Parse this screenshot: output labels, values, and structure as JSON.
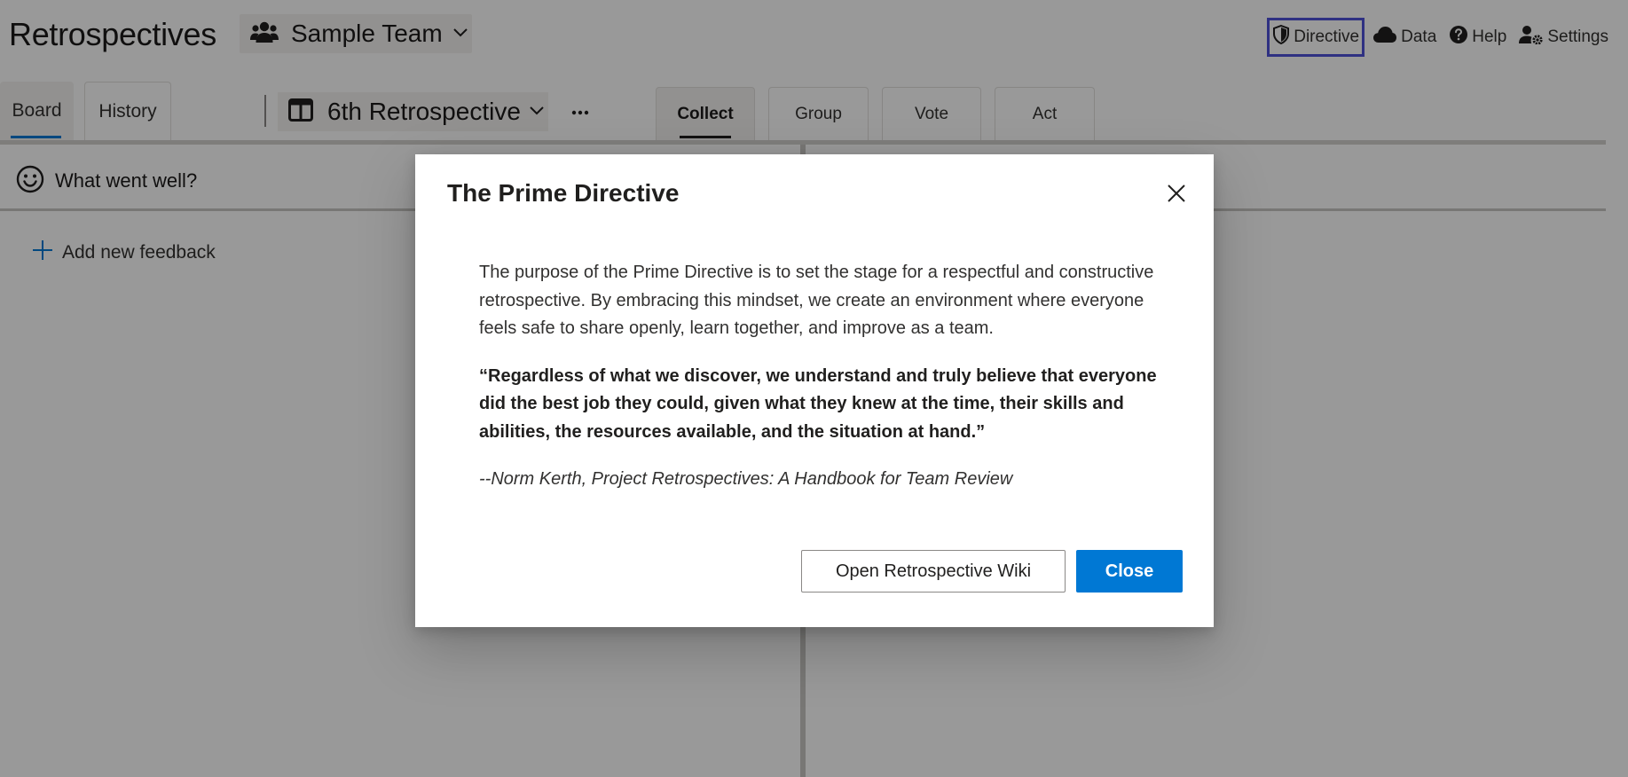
{
  "header": {
    "app_title": "Retrospectives",
    "team_name": "Sample Team",
    "links": {
      "directive": "Directive",
      "data": "Data",
      "help": "Help",
      "settings": "Settings"
    }
  },
  "tabs": {
    "board": "Board",
    "history": "History"
  },
  "retro_selector": {
    "name": "6th Retrospective",
    "more_label": "···"
  },
  "phases": {
    "collect": "Collect",
    "group": "Group",
    "vote": "Vote",
    "act": "Act"
  },
  "board": {
    "column_title": "What went well?",
    "add_feedback": "Add new feedback"
  },
  "dialog": {
    "title": "The Prime Directive",
    "purpose": "The purpose of the Prime Directive is to set the stage for a respectful and constructive retrospective. By embracing this mindset, we create an environment where everyone feels safe to share openly, learn together, and improve as a team.",
    "quote": "“Regardless of what we discover, we understand and truly believe that everyone did the best job they could, given what they knew at the time, their skills and abilities, the resources available, and the situation at hand.”",
    "attribution": "--Norm Kerth, Project Retrospectives: A Handbook for Team Review",
    "wiki_button": "Open Retrospective Wiki",
    "close_button": "Close"
  },
  "colors": {
    "accent": "#0078d4",
    "focus_outline": "#4f52d9",
    "overlay": "rgba(0,0,0,0.40)"
  },
  "icons": {
    "team": "people-icon",
    "retro": "board-layout-icon",
    "directive": "shield-icon",
    "data": "cloud-icon",
    "help": "help-circle-icon",
    "settings": "person-gear-icon",
    "column": "smiley-icon",
    "add": "plus-icon",
    "close": "close-icon"
  }
}
